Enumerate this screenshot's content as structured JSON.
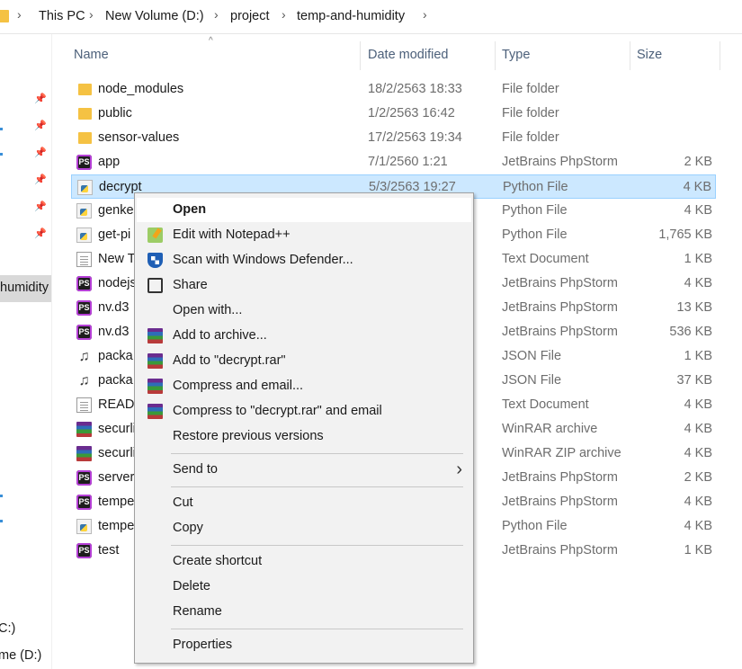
{
  "breadcrumb": {
    "items": [
      "This PC",
      "New Volume (D:)",
      "project",
      "temp-and-humidity"
    ]
  },
  "nav": {
    "selected_label": "humidity",
    "drive_c": "C:)",
    "drive_d": "me (D:)"
  },
  "columns": {
    "name": "Name",
    "date": "Date modified",
    "type": "Type",
    "size": "Size"
  },
  "files": [
    {
      "name": "node_modules",
      "date": "18/2/2563 18:33",
      "type": "File folder",
      "size": "",
      "icon": "folder-icon"
    },
    {
      "name": "public",
      "date": "1/2/2563 16:42",
      "type": "File folder",
      "size": "",
      "icon": "folder-icon"
    },
    {
      "name": "sensor-values",
      "date": "17/2/2563 19:34",
      "type": "File folder",
      "size": "",
      "icon": "folder-icon"
    },
    {
      "name": "app",
      "date": "7/1/2560 1:21",
      "type": "JetBrains PhpStorm",
      "size": "2 KB",
      "icon": "phpstorm-icon"
    },
    {
      "name": "decrypt",
      "date": "5/3/2563 19:27",
      "type": "Python File",
      "size": "4 KB",
      "icon": "python-file-icon"
    },
    {
      "name": "genke",
      "date": "",
      "type": "Python File",
      "size": "4 KB",
      "icon": "python-file-icon"
    },
    {
      "name": "get-pi",
      "date": "",
      "type": "Python File",
      "size": "1,765 KB",
      "icon": "python-file-icon"
    },
    {
      "name": "New T",
      "date": "",
      "type": "Text Document",
      "size": "1 KB",
      "icon": "text-file-icon"
    },
    {
      "name": "nodejs",
      "date": "",
      "type": "JetBrains PhpStorm",
      "size": "4 KB",
      "icon": "phpstorm-icon"
    },
    {
      "name": "nv.d3",
      "date": "",
      "type": "JetBrains PhpStorm",
      "size": "13 KB",
      "icon": "phpstorm-icon"
    },
    {
      "name": "nv.d3",
      "date": "",
      "type": "JetBrains PhpStorm",
      "size": "536 KB",
      "icon": "phpstorm-icon"
    },
    {
      "name": "packa",
      "date": "",
      "type": "JSON File",
      "size": "1 KB",
      "icon": "json-file-icon"
    },
    {
      "name": "packa",
      "date": "",
      "type": "JSON File",
      "size": "37 KB",
      "icon": "json-file-icon"
    },
    {
      "name": "READI",
      "date": "",
      "type": "Text Document",
      "size": "4 KB",
      "icon": "text-file-icon"
    },
    {
      "name": "securli",
      "date": "",
      "type": "WinRAR archive",
      "size": "4 KB",
      "icon": "winrar-icon"
    },
    {
      "name": "securli",
      "date": "",
      "type": "WinRAR ZIP archive",
      "size": "4 KB",
      "icon": "winrar-icon"
    },
    {
      "name": "server",
      "date": "",
      "type": "JetBrains PhpStorm",
      "size": "2 KB",
      "icon": "phpstorm-icon"
    },
    {
      "name": "tempe",
      "date": "",
      "type": "JetBrains PhpStorm",
      "size": "4 KB",
      "icon": "phpstorm-icon"
    },
    {
      "name": "tempe",
      "date": "",
      "type": "Python File",
      "size": "4 KB",
      "icon": "python-file-icon"
    },
    {
      "name": "test",
      "date": "",
      "type": "JetBrains PhpStorm",
      "size": "1 KB",
      "icon": "phpstorm-icon"
    }
  ],
  "selected_row": 4,
  "context_menu": {
    "items": [
      {
        "label": "Open",
        "bold": true,
        "icon": ""
      },
      {
        "label": "Edit with Notepad++",
        "icon": "notepadpp-icon"
      },
      {
        "label": "Scan with Windows Defender...",
        "icon": "defender-icon"
      },
      {
        "label": "Share",
        "icon": "share-icon"
      },
      {
        "label": "Open with...",
        "icon": ""
      },
      {
        "label": "Add to archive...",
        "icon": "winrar-icon"
      },
      {
        "label": "Add to \"decrypt.rar\"",
        "icon": "winrar-icon"
      },
      {
        "label": "Compress and email...",
        "icon": "winrar-icon"
      },
      {
        "label": "Compress to \"decrypt.rar\" and email",
        "icon": "winrar-icon"
      },
      {
        "label": "Restore previous versions",
        "icon": ""
      },
      {
        "label": "Send to",
        "icon": "",
        "submenu": true
      },
      {
        "label": "Cut",
        "icon": ""
      },
      {
        "label": "Copy",
        "icon": ""
      },
      {
        "label": "Create shortcut",
        "icon": ""
      },
      {
        "label": "Delete",
        "icon": ""
      },
      {
        "label": "Rename",
        "icon": ""
      },
      {
        "label": "Properties",
        "icon": ""
      }
    ]
  },
  "colors": {
    "selection_bg": "#cce8ff",
    "selection_border": "#99d1ff",
    "folder": "#f5c243",
    "menu_bg": "#f2f2f2"
  }
}
